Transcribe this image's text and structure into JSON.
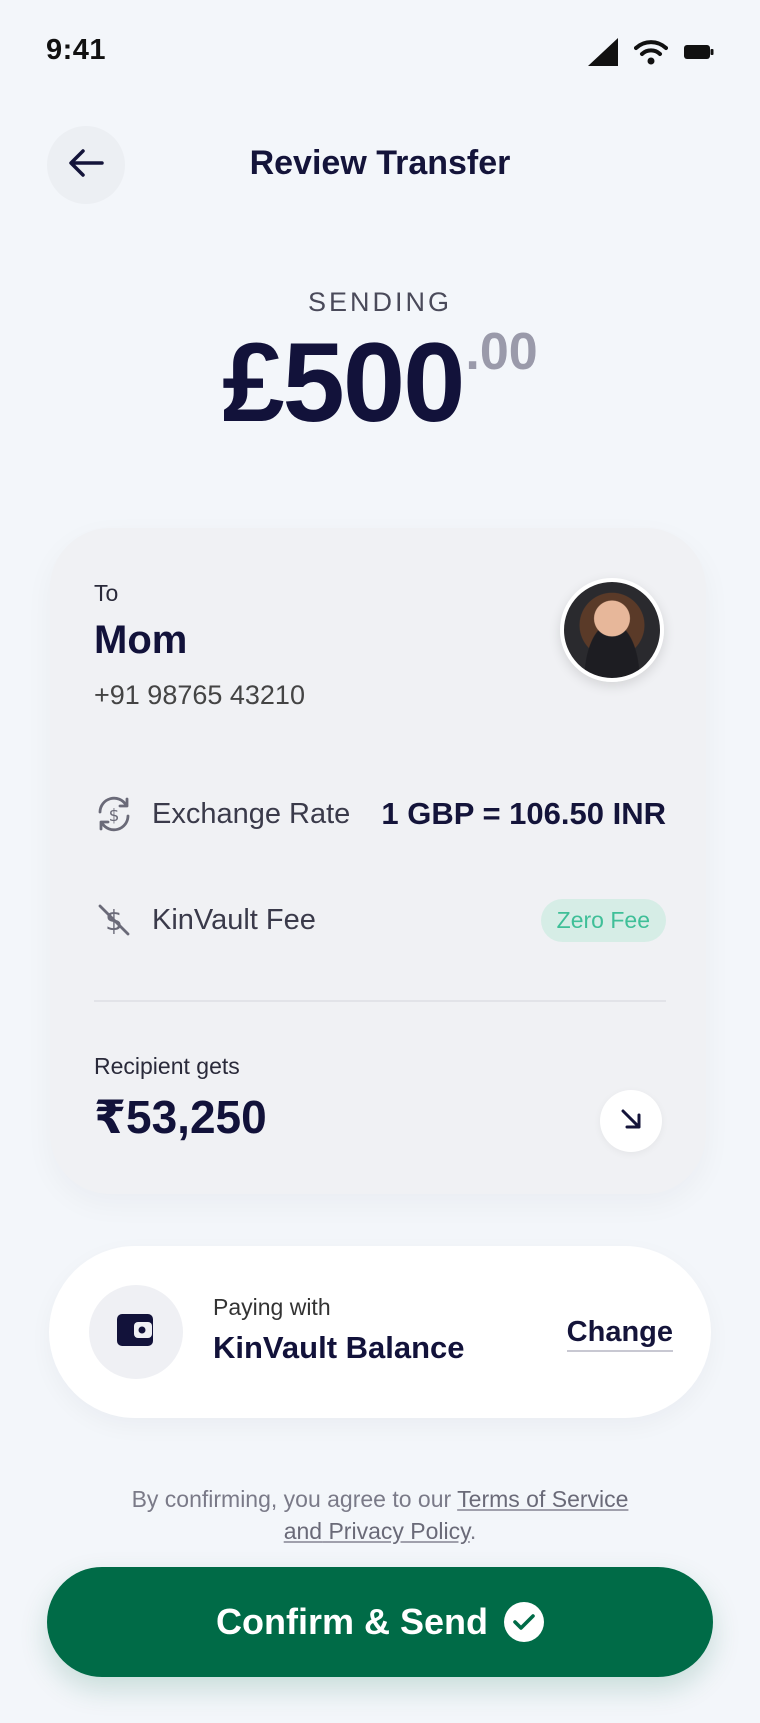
{
  "status_bar": {
    "time": "9:41",
    "icons": [
      "signal-icon",
      "wifi-icon",
      "battery-icon"
    ]
  },
  "header": {
    "back_icon": "arrow-left-icon",
    "title": "Review Transfer"
  },
  "sending": {
    "label": "SENDING",
    "amount_main": "£500",
    "amount_cents": ".00"
  },
  "recipient": {
    "to_label": "To",
    "name": "Mom",
    "phone": "+91 98765 43210"
  },
  "details": {
    "exchange_rate_label": "Exchange Rate",
    "exchange_rate_value": "1 GBP = 106.50 INR",
    "exchange_rate_icon": "currency-exchange-icon",
    "fee_label": "KinVault Fee",
    "fee_value": "Zero Fee",
    "fee_icon": "no-fee-icon"
  },
  "recipient_gets": {
    "label": "Recipient gets",
    "value": "₹53,250",
    "icon": "arrow-down-right-icon"
  },
  "payment": {
    "label": "Paying with",
    "method": "KinVault Balance",
    "change_label": "Change",
    "icon": "wallet-icon"
  },
  "terms": {
    "prefix": "By confirming, you agree to our ",
    "terms_link": "Terms of Service",
    "middle": "and",
    "privacy_link": " Privacy Policy",
    "suffix": "."
  },
  "confirm": {
    "label": "Confirm & Send",
    "icon": "check-circle-icon"
  },
  "colors": {
    "background": "#f3f6fa",
    "primary": "#006b47",
    "text": "#14143a",
    "fee_badge_bg": "#d6ede6",
    "fee_badge_text": "#3fbf98"
  }
}
